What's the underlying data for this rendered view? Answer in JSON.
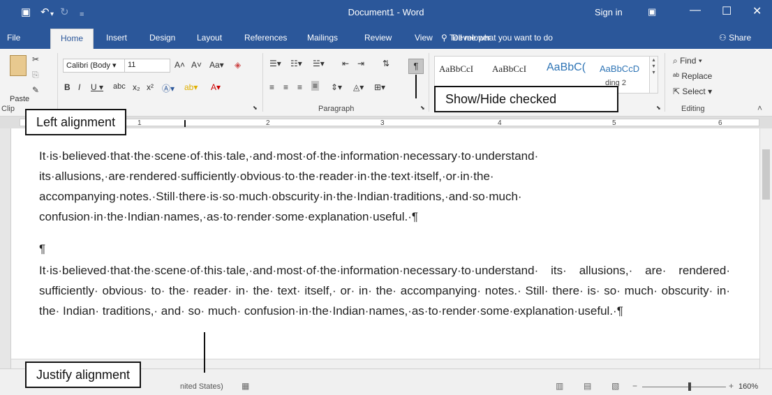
{
  "window": {
    "title": "Document1  -  Word",
    "sign_in": "Sign in"
  },
  "tabs": [
    {
      "label": "File"
    },
    {
      "label": "Home"
    },
    {
      "label": "Insert"
    },
    {
      "label": "Design"
    },
    {
      "label": "Layout"
    },
    {
      "label": "References"
    },
    {
      "label": "Mailings"
    },
    {
      "label": "Review"
    },
    {
      "label": "View"
    },
    {
      "label": "Developer"
    }
  ],
  "tell_me": "Tell me what you want to do",
  "share": "Share",
  "ribbon": {
    "paste": "Paste",
    "font_name": "Calibri (Body",
    "font_size": "11",
    "paragraph_label": "Paragraph",
    "clipboard_label": "Clip",
    "styles": [
      "AaBbCcI",
      "AaBbCcI",
      "AaBbC(",
      "AaBbCcD"
    ],
    "style_partial": "ding 2",
    "find": "Find",
    "replace": "Replace",
    "select": "Select",
    "editing_label": "Editing"
  },
  "ruler_numbers": [
    "1",
    "2",
    "3",
    "4",
    "5",
    "6"
  ],
  "document": {
    "para1": "It·is·believed·that·the·scene·of·this·tale,·and·most·of·the·information·necessary·to·understand· its·allusions,·are·rendered·sufficiently·obvious·to·the·reader·in·the·text·itself,·or·in·the· accompanying·notes.·Still·there·is·so·much·obscurity·in·the·Indian·traditions,·and·so·much· confusion·in·the·Indian·names,·as·to·render·some·explanation·useful.·¶",
    "empty_mark": "¶",
    "para2": "It·is·believed·that·the·scene·of·this·tale,·and·most·of·the·information·necessary·to·understand· its· allusions,· are· rendered· sufficiently· obvious· to· the· reader· in· the· text· itself,· or· in· the· accompanying· notes.· Still· there· is· so· much· obscurity· in· the· Indian· traditions,· and· so· much· confusion·in·the·Indian·names,·as·to·render·some·explanation·useful.·¶"
  },
  "status": {
    "language": "nited States)",
    "zoom": "160%"
  },
  "callouts": {
    "left_alignment": "Left alignment",
    "show_hide": "Show/Hide checked",
    "justify_alignment": "Justify alignment"
  },
  "colors": {
    "titlebar": "#2b579a",
    "ribbon": "#f3f3f3",
    "pilcrow_checked": "#c5c5c5"
  }
}
